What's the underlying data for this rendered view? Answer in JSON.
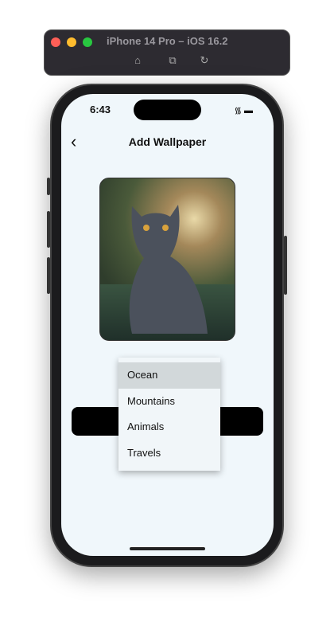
{
  "simulator": {
    "title": "iPhone 14 Pro – iOS 16.2",
    "icons": [
      "home-icon",
      "screenshot-icon",
      "rotate-icon"
    ],
    "traffic_colors": [
      "#fe5f57",
      "#febc2e",
      "#28c840"
    ]
  },
  "status_bar": {
    "time": "6:43"
  },
  "header": {
    "title": "Add Wallpaper",
    "back_icon": "chevron-left-icon"
  },
  "dropdown": {
    "items": [
      {
        "label": "Ocean",
        "selected": true
      },
      {
        "label": "Mountains"
      },
      {
        "label": "Animals"
      },
      {
        "label": "Travels"
      }
    ]
  },
  "colors": {
    "screen_bg": "#f0f7fb",
    "button": "#000000",
    "selected_item": "#d2d8da"
  }
}
